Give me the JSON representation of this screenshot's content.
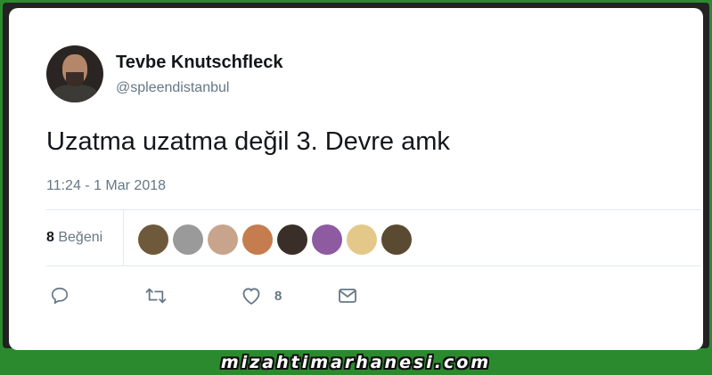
{
  "tweet": {
    "display_name": "Tevbe Knutschfleck",
    "handle": "@spleendistanbul",
    "text": "Uzatma uzatma değil 3. Devre amk",
    "timestamp": "11:24 - 1 Mar 2018"
  },
  "stats": {
    "likes_count": "8",
    "likes_label": "Beğeni"
  },
  "likers": [
    {
      "color": "#6e5a3a"
    },
    {
      "color": "#9a9a9a"
    },
    {
      "color": "#c8a48c"
    },
    {
      "color": "#c57c4f"
    },
    {
      "color": "#3a2f28"
    },
    {
      "color": "#8e5aa0"
    },
    {
      "color": "#e4c88a"
    },
    {
      "color": "#5b4a32"
    }
  ],
  "actions": {
    "like_count": "8"
  },
  "colors": {
    "background": "#2c8a2e",
    "text_primary": "#14171a",
    "text_secondary": "#657786",
    "divider": "#e1e8ed"
  },
  "watermark": "mizahtimarhanesi.com"
}
